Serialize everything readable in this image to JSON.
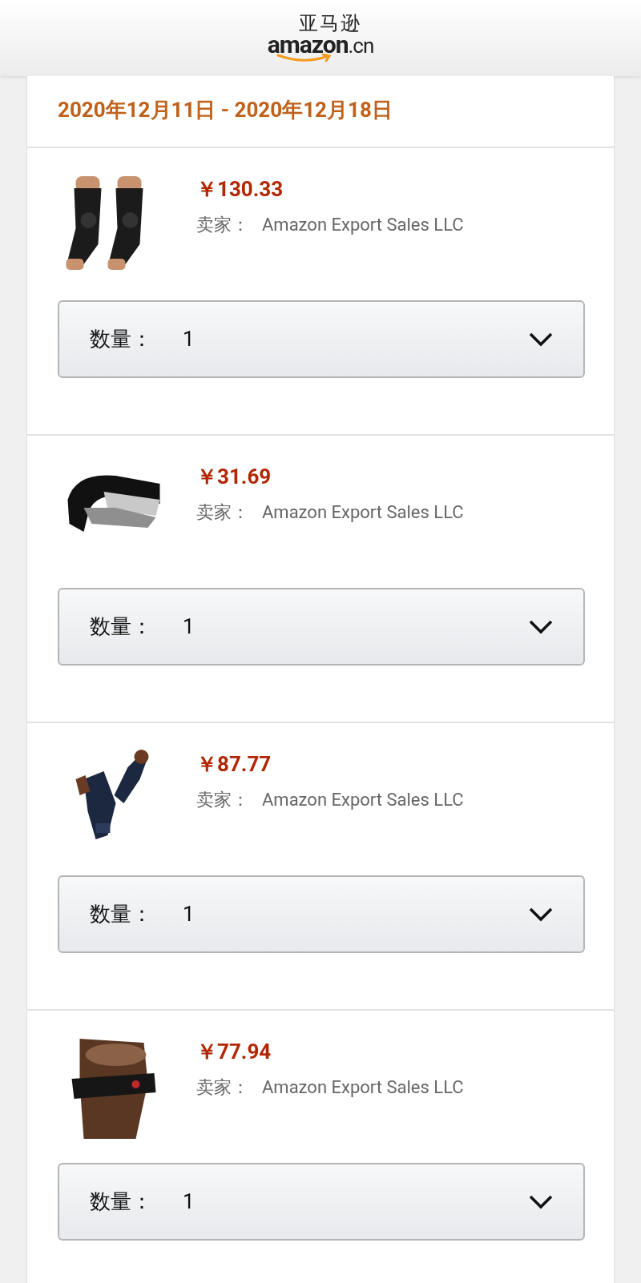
{
  "header": {
    "logo_cn": "亚马逊",
    "logo_en": "amazon",
    "logo_suffix": ".cn"
  },
  "delivery": {
    "dates": "2020年12月11日 - 2020年12月18日"
  },
  "items": [
    {
      "price": "￥130.33",
      "seller_label": "卖家：",
      "seller": "Amazon Export Sales LLC",
      "quantity_label": "数量：",
      "quantity": "1"
    },
    {
      "price": "￥31.69",
      "seller_label": "卖家：",
      "seller": "Amazon Export Sales LLC",
      "quantity_label": "数量：",
      "quantity": "1"
    },
    {
      "price": "￥87.77",
      "seller_label": "卖家：",
      "seller": "Amazon Export Sales LLC",
      "quantity_label": "数量：",
      "quantity": "1"
    },
    {
      "price": "￥77.94",
      "seller_label": "卖家：",
      "seller": "Amazon Export Sales LLC",
      "quantity_label": "数量：",
      "quantity": "1"
    }
  ]
}
